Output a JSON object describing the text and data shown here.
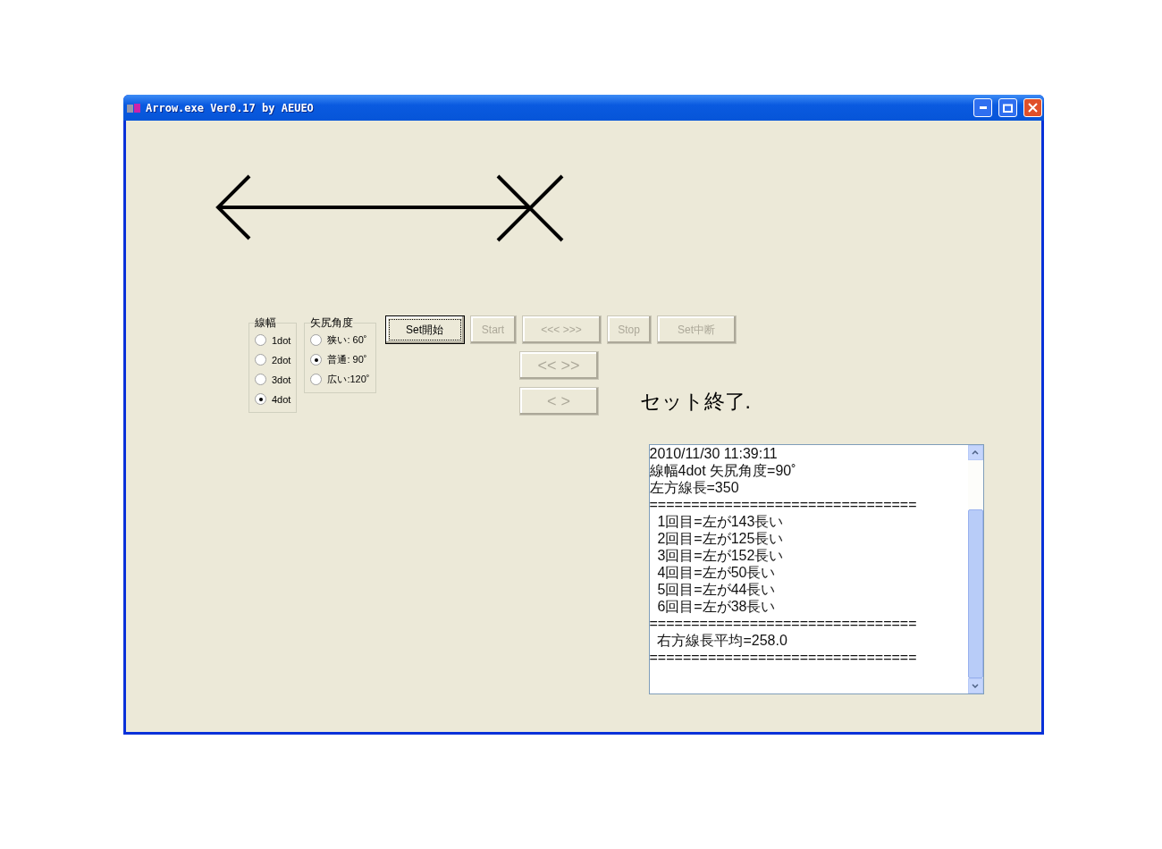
{
  "window": {
    "title": "Arrow.exe Ver0.17 by AEUEO"
  },
  "line_width": {
    "label": "線幅",
    "options": [
      {
        "label": "1dot",
        "selected": false
      },
      {
        "label": "2dot",
        "selected": false
      },
      {
        "label": "3dot",
        "selected": false
      },
      {
        "label": "4dot",
        "selected": true
      }
    ]
  },
  "arrow_angle": {
    "label": "矢尻角度",
    "options": [
      {
        "label": "狭い: 60˚",
        "selected": false
      },
      {
        "label": "普通: 90˚",
        "selected": true
      },
      {
        "label": "広い:120˚",
        "selected": false
      }
    ]
  },
  "buttons": [
    {
      "label": "Set開始",
      "disabled": false,
      "focused": true
    },
    {
      "label": "Start",
      "disabled": true,
      "focused": false
    },
    {
      "label": "<<< >>>",
      "disabled": true,
      "focused": false
    },
    {
      "label": "Stop",
      "disabled": true,
      "focused": false
    },
    {
      "label": "Set中断",
      "disabled": true,
      "focused": false
    }
  ],
  "step_buttons": [
    {
      "label": "<< >>",
      "disabled": true
    },
    {
      "label": "< >",
      "disabled": true
    }
  ],
  "status": "セット終了.",
  "log": {
    "lines": [
      "2010/11/30 11:39:11",
      "線幅4dot 矢尻角度=90˚",
      "左方線長=350",
      "================================",
      "  1回目=左が143長い",
      "  2回目=左が125長い",
      "  3回目=左が152長い",
      "  4回目=左が50長い",
      "  5回目=左が44長い",
      "  6回目=左が38長い",
      "================================",
      "  右方線長平均=258.0",
      "================================"
    ]
  }
}
